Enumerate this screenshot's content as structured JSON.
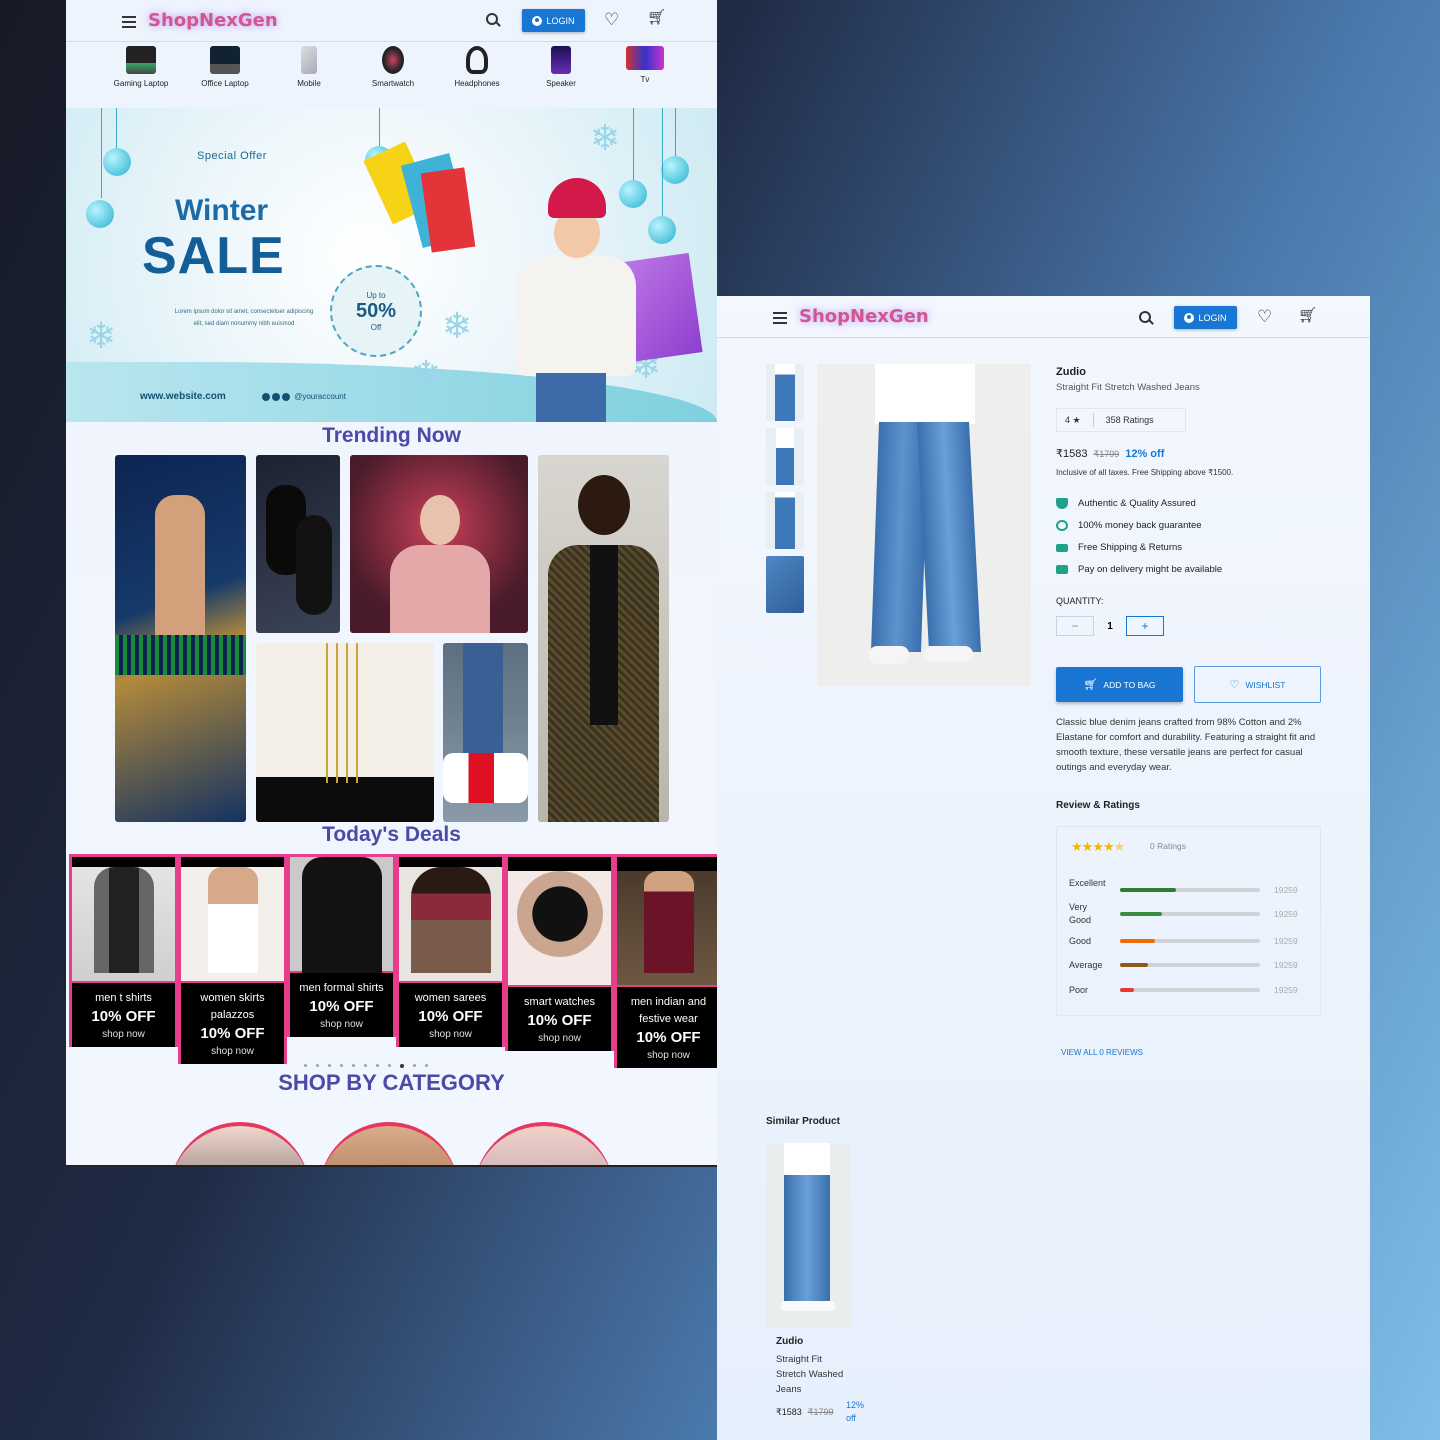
{
  "home": {
    "brand": "ShopNexGen",
    "login_label": "LOGIN",
    "categories": [
      {
        "label": "Gaming Laptop",
        "icon": "gaming-laptop-icon"
      },
      {
        "label": "Office Laptop",
        "icon": "office-laptop-icon"
      },
      {
        "label": "Mobile",
        "icon": "mobile-icon"
      },
      {
        "label": "Smartwatch",
        "icon": "smartwatch-icon"
      },
      {
        "label": "Headphones",
        "icon": "headphones-icon"
      },
      {
        "label": "Speaker",
        "icon": "speaker-icon"
      },
      {
        "label": "Tv",
        "icon": "tv-icon"
      }
    ],
    "banner": {
      "special": "Special Offer",
      "winter": "Winter",
      "sale": "SALE",
      "upto": "Up to",
      "percent": "50%",
      "off": "Off",
      "lorem": "Lorem ipsum dolor sit amet, consectetuer adipiscing elit, sed diam nonummy nibh euismod",
      "website": "www.website.com",
      "account": "@youraccount"
    },
    "trending_title": "Trending Now",
    "deals_title": "Today's Deals",
    "deals": [
      {
        "caption": "men t shirts",
        "off": "10% OFF",
        "cta": "shop now"
      },
      {
        "caption": "women skirts palazzos",
        "off": "10% OFF",
        "cta": "shop now"
      },
      {
        "caption": "men formal shirts",
        "off": "10% OFF",
        "cta": "shop now"
      },
      {
        "caption": "women sarees",
        "off": "10% OFF",
        "cta": "shop now"
      },
      {
        "caption": "smart watches",
        "off": "10% OFF",
        "cta": "shop now"
      },
      {
        "caption": "men indian and festive wear",
        "off": "10% OFF",
        "cta": "shop now"
      }
    ],
    "carousel_active_dot": 8,
    "carousel_dot_count": 11,
    "shop_by_category_title": "SHOP BY CATEGORY"
  },
  "product": {
    "brand": "ShopNexGen",
    "login_label": "LOGIN",
    "name_brand": "Zudio",
    "name": "Straight Fit Stretch Washed Jeans",
    "rating": "4 ★",
    "ratings_count": "358 Ratings",
    "price": "₹1583",
    "mrp": "₹1799",
    "discount": "12% off",
    "inclusive_note": "Inclusive of all taxes. Free Shipping above ₹1500.",
    "features": [
      {
        "label": "Authentic & Quality Assured",
        "icon": "shield-icon"
      },
      {
        "label": "100% money back guarantee",
        "icon": "badge-icon"
      },
      {
        "label": "Free Shipping & Returns",
        "icon": "truck-icon"
      },
      {
        "label": "Pay on delivery might be available",
        "icon": "card-icon"
      }
    ],
    "quantity_label": "QUANTITY:",
    "quantity": "1",
    "minus": "−",
    "plus": "+",
    "add_to_bag": "ADD TO BAG",
    "wishlist": "WISHLIST",
    "description": "Classic blue denim jeans crafted from 98% Cotton and 2% Elastane for comfort and durability. Featuring a straight fit and smooth texture, these versatile jeans are perfect for casual outings and everyday wear.",
    "review_title": "Review & Ratings",
    "stars_value": 4.5,
    "zero_ratings": "0 Ratings",
    "rating_bars": [
      {
        "label": "Excellent",
        "count": "19259",
        "fraction": 0.4,
        "color": "#2e7d32"
      },
      {
        "label": "Very Good",
        "count": "19259",
        "fraction": 0.3,
        "color": "#388e3c"
      },
      {
        "label": "Good",
        "count": "19259",
        "fraction": 0.25,
        "color": "#ef6c00"
      },
      {
        "label": "Average",
        "count": "19259",
        "fraction": 0.2,
        "color": "#8d5a1a"
      },
      {
        "label": "Poor",
        "count": "19259",
        "fraction": 0.1,
        "color": "#e53935"
      }
    ],
    "view_all": "VIEW ALL 0 REVIEWS",
    "similar_title": "Similar Product",
    "similar": {
      "brand": "Zudio",
      "name": "Straight Fit Stretch Washed Jeans",
      "price": "₹1583",
      "mrp": "₹1799",
      "discount": "12% off"
    }
  }
}
